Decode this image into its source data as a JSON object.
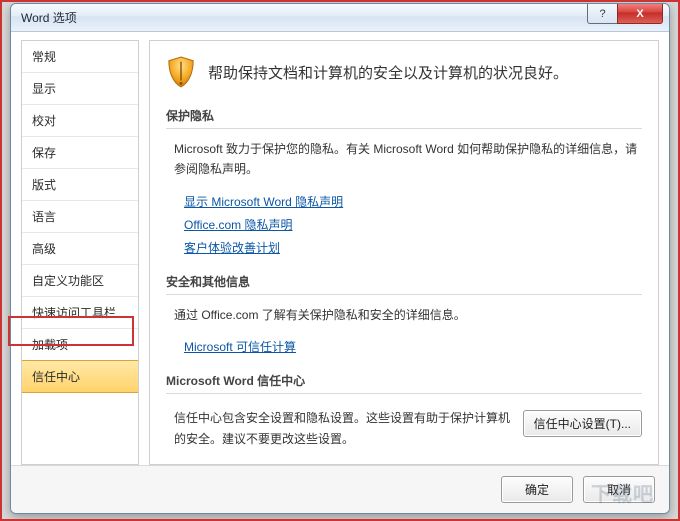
{
  "titlebar": {
    "title": "Word 选项",
    "help": "?",
    "close": "X"
  },
  "sidebar": {
    "items": [
      {
        "label": "常规"
      },
      {
        "label": "显示"
      },
      {
        "label": "校对"
      },
      {
        "label": "保存"
      },
      {
        "label": "版式"
      },
      {
        "label": "语言"
      },
      {
        "label": "高级"
      },
      {
        "label": "自定义功能区"
      },
      {
        "label": "快速访问工具栏"
      },
      {
        "label": "加载项"
      },
      {
        "label": "信任中心"
      }
    ],
    "selected_index": 10
  },
  "hero": {
    "text": "帮助保持文档和计算机的安全以及计算机的状况良好。"
  },
  "sections": {
    "privacy": {
      "title": "保护隐私",
      "body": "Microsoft 致力于保护您的隐私。有关 Microsoft Word 如何帮助保护隐私的详细信息，请参阅隐私声明。",
      "links": [
        "显示 Microsoft Word 隐私声明",
        "Office.com 隐私声明",
        "客户体验改善计划"
      ]
    },
    "security": {
      "title": "安全和其他信息",
      "body": "通过 Office.com 了解有关保护隐私和安全的详细信息。",
      "link": "Microsoft 可信任计算"
    },
    "trust": {
      "title": "Microsoft Word 信任中心",
      "body": "信任中心包含安全设置和隐私设置。这些设置有助于保护计算机的安全。建议不要更改这些设置。",
      "button": "信任中心设置(T)..."
    }
  },
  "footer": {
    "ok": "确定",
    "cancel": "取消"
  },
  "watermark": "下载吧"
}
